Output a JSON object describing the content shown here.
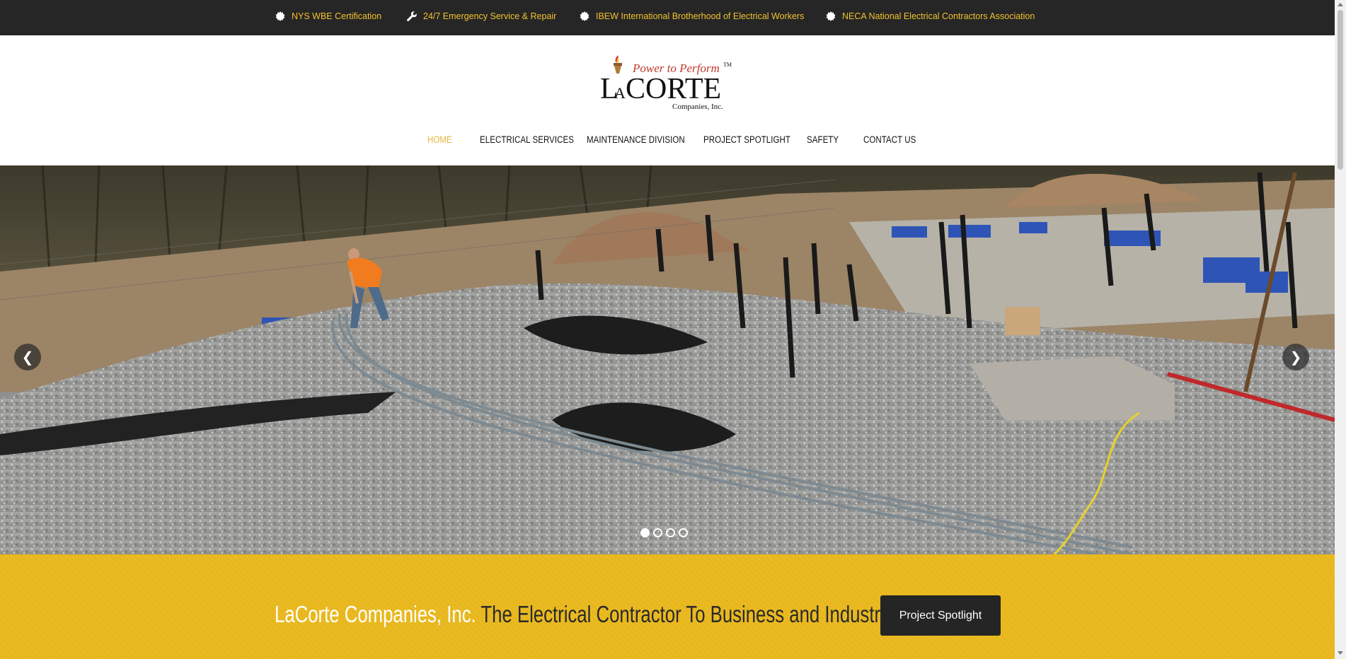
{
  "topbar": {
    "items": [
      {
        "label": "NYS WBE Certification",
        "icon": "badge-icon"
      },
      {
        "label": "24/7 Emergency Service & Repair",
        "icon": "wrench-icon"
      },
      {
        "label": "IBEW International Brotherhood of Electrical Workers",
        "icon": "badge-icon"
      },
      {
        "label": "NECA National Electrical Contractors Association",
        "icon": "badge-icon"
      }
    ],
    "text_color": "#f2c12e",
    "background": "#262626"
  },
  "logo": {
    "slogan": "Power to Perform",
    "trademark": "TM",
    "name_parts": [
      "L",
      "A",
      "CORTE"
    ],
    "subtitle": "Companies, Inc."
  },
  "nav": {
    "items": [
      "HOME",
      "ELECTRICAL SERVICES",
      "MAINTENANCE DIVISION",
      "PROJECT SPOTLIGHT",
      "SAFETY",
      "CONTACT US"
    ],
    "active": "HOME",
    "active_color": "#e8b53a"
  },
  "hero": {
    "slide_count": 4,
    "active_slide": 1,
    "prev_icon": "chevron-left-icon",
    "next_icon": "chevron-right-icon"
  },
  "band": {
    "brand": "LaCorte Companies, Inc.",
    "tagline": "The Electrical Contractor To Business and Industry",
    "button_label": "Project Spotlight",
    "background": "#e8b71c"
  }
}
